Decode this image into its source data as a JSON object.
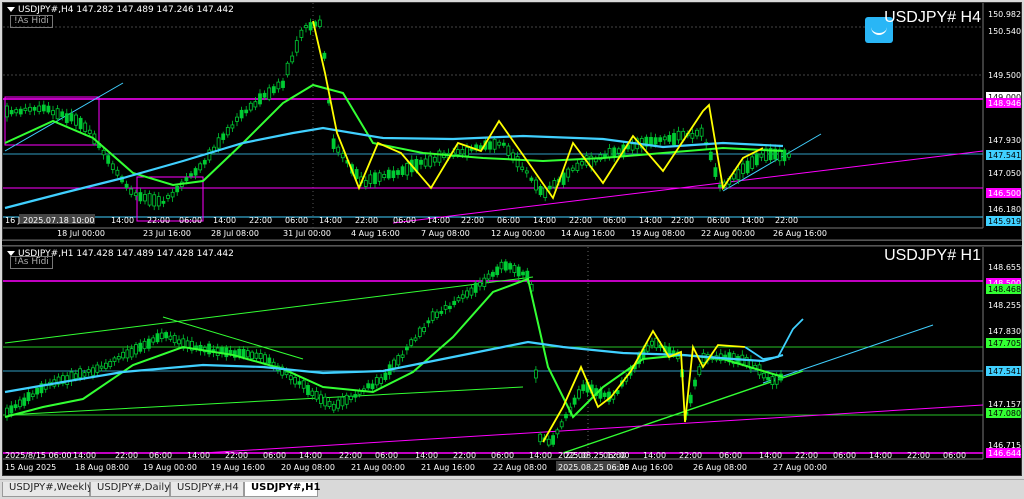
{
  "h4": {
    "header": "USDJPY#,H4  147.282 147.489 147.246 147.442",
    "as_hidden": "!As Hidi",
    "symbol_title": "USDJPY# H4",
    "price_labels": [
      "150.982",
      "150.540",
      "149.500",
      "149.000",
      "148.946",
      "147.930",
      "147.541",
      "147.050",
      "146.500",
      "146.180",
      "145.919"
    ],
    "time_labels": [
      "16 J",
      "2025.07.18 10:00",
      "14:00",
      "22:00",
      "06:00",
      "14:00",
      "22:00",
      "06:00",
      "14:00",
      "22:00",
      "06:00",
      "14:00",
      "22:00",
      "06:00",
      "14:00",
      "22:00",
      "06:00",
      "14:00",
      "22:00",
      "06:00",
      "14:00",
      "22:00"
    ],
    "date_labels": [
      "18 Jul 00:00",
      "23 Jul 16:00",
      "28 Jul 08:00",
      "31 Jul 00:00",
      "4 Aug 16:00",
      "7 Aug 08:00",
      "12 Aug 00:00",
      "14 Aug 16:00",
      "19 Aug 08:00",
      "22 Aug 00:00",
      "26 Aug 16:00"
    ]
  },
  "h1": {
    "header": "USDJPY#,H1  147.428 147.489 147.428 147.442",
    "as_hidden": "!As Hidi",
    "symbol_title": "USDJPY# H1",
    "price_labels": [
      "148.655",
      "148.500",
      "148.468",
      "148.255",
      "147.830",
      "147.705",
      "147.541",
      "147.157",
      "147.080",
      "146.715",
      "146.644"
    ],
    "time_labels": [
      "2025/8/15 06:00",
      "14:00",
      "22:00",
      "06:00",
      "14:00",
      "22:00",
      "06:00",
      "14:00",
      "22:00",
      "06:00",
      "14:00",
      "22:00",
      "06:00",
      "14:00",
      "22:00",
      "06:00",
      "14:00",
      "22:00",
      "2025.08.25 12:00",
      "06:00",
      "14:00",
      "22:00",
      "06:00",
      "14:00",
      "22:00",
      "06:00"
    ],
    "date_labels": [
      "15 Aug 2025",
      "18 Aug 08:00",
      "19 Aug 00:00",
      "19 Aug 16:00",
      "20 Aug 08:00",
      "21 Aug 00:00",
      "21 Aug 16:00",
      "22 Aug 08:00",
      "2025.08.25 06:00",
      "25 Aug 16:00",
      "26 Aug 08:00",
      "27 Aug 00:00"
    ]
  },
  "tabs": [
    "USDJPY#,Weekly",
    "USDJPY#,Daily",
    "USDJPY#,H4",
    "USDJPY#,H1"
  ],
  "active_tab": "USDJPY#,H1",
  "colors": {
    "magenta": "#ff00ff",
    "yellow": "#ffff00",
    "green": "#33ff33",
    "cyan": "#40d0ff",
    "candle": "#00cc33"
  }
}
